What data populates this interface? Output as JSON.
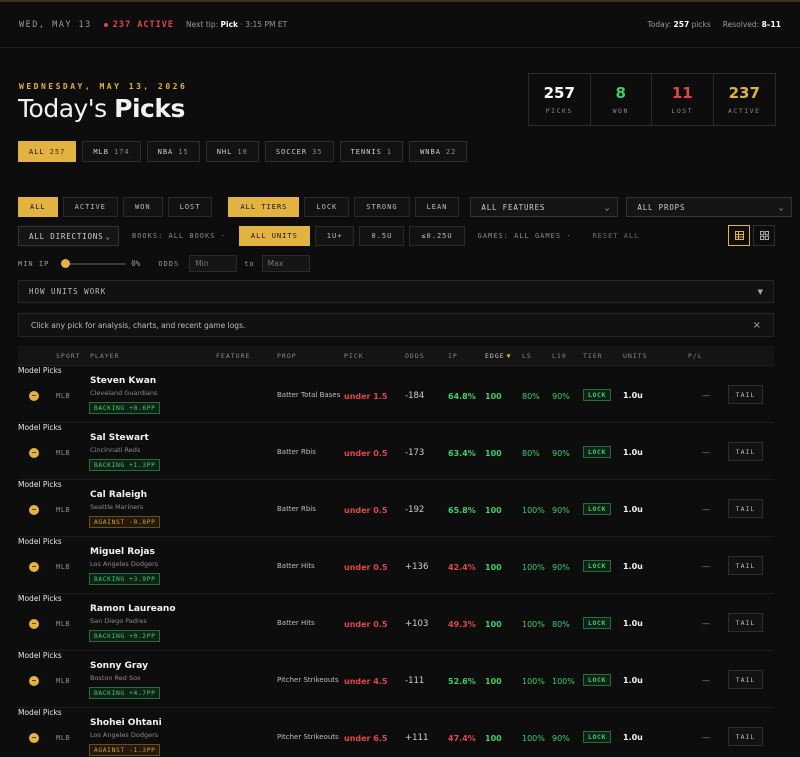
{
  "topbar": {
    "date": "WED, MAY 13",
    "active": "237 ACTIVE",
    "next_tip_label": "Next tip:",
    "next_tip_value": "Pick",
    "next_tip_time": "· 3:15 PM ET",
    "today_label": "Today:",
    "today_value": "257",
    "today_suffix": "picks",
    "resolved_label": "Resolved:",
    "resolved_value": "8–11"
  },
  "header": {
    "subtitle": "WEDNESDAY, MAY 13, 2026",
    "title_light": "Today's",
    "title_bold": "Picks"
  },
  "stats": [
    {
      "value": "257",
      "label": "PICKS",
      "color": "#ffffff"
    },
    {
      "value": "8",
      "label": "WON",
      "color": "#3fcf6a"
    },
    {
      "value": "11",
      "label": "LOST",
      "color": "#e0474c"
    },
    {
      "value": "237",
      "label": "ACTIVE",
      "color": "#e3b341"
    }
  ],
  "sports": [
    {
      "label": "ALL",
      "count": "257"
    },
    {
      "label": "MLB",
      "count": "174"
    },
    {
      "label": "NBA",
      "count": "15"
    },
    {
      "label": "NHL",
      "count": "10"
    },
    {
      "label": "SOCCER",
      "count": "35"
    },
    {
      "label": "TENNIS",
      "count": "1"
    },
    {
      "label": "WNBA",
      "count": "22"
    }
  ],
  "filters": {
    "status": [
      "ALL",
      "ACTIVE",
      "WON",
      "LOST"
    ],
    "tiers": [
      "ALL TIERS",
      "LOCK",
      "STRONG",
      "LEAN"
    ],
    "features_select": "ALL FEATURES",
    "props_select": "ALL PROPS",
    "directions_select": "ALL DIRECTIONS",
    "books": "BOOKS: ALL BOOKS ·",
    "units": [
      "ALL UNITS",
      "1U+",
      "0.5U",
      "≤0.25U"
    ],
    "games": "GAMES: ALL GAMES ·",
    "reset": "RESET ALL",
    "min_ip_label": "MIN IP",
    "min_ip_value": "0%",
    "odds_label": "ODDS",
    "odds_min_placeholder": "Min",
    "odds_to": "to",
    "odds_max_placeholder": "Max"
  },
  "how_units": "HOW UNITS WORK",
  "info_text": "Click any pick for analysis, charts, and recent game logs.",
  "columns": {
    "sport": "SPORT",
    "player": "PLAYER",
    "feature": "FEATURE",
    "prop": "PROP",
    "pick": "PICK",
    "odds": "ODDS",
    "ip": "IP",
    "edge": "EDGE",
    "l5": "L5",
    "l10": "L10",
    "tier": "TIER",
    "units": "UNITS",
    "pl": "P/L"
  },
  "rows": [
    {
      "sport": "MLB",
      "name": "Steven Kwan",
      "team": "Cleveland Guardians",
      "badge": "BACKING +0.6PP",
      "badge_type": "back",
      "feature": "Model Picks",
      "prop": "Batter Total Bases",
      "pick": "under 1.5",
      "odds": "-184",
      "ip": "64.8%",
      "ip_color": "green",
      "edge": "100",
      "l5": "80%",
      "l10": "90%",
      "tier": "LOCK",
      "units": "1.0u",
      "pl": "—",
      "action": "TAIL"
    },
    {
      "sport": "MLB",
      "name": "Sal Stewart",
      "team": "Cincinnati Reds",
      "badge": "BACKING +1.3PP",
      "badge_type": "back",
      "feature": "Model Picks",
      "prop": "Batter Rbis",
      "pick": "under 0.5",
      "odds": "-173",
      "ip": "63.4%",
      "ip_color": "green",
      "edge": "100",
      "l5": "80%",
      "l10": "90%",
      "tier": "LOCK",
      "units": "1.0u",
      "pl": "—",
      "action": "TAIL"
    },
    {
      "sport": "MLB",
      "name": "Cal Raleigh",
      "team": "Seattle Mariners",
      "badge": "AGAINST -0.8PP",
      "badge_type": "against",
      "feature": "Model Picks",
      "prop": "Batter Rbis",
      "pick": "under 0.5",
      "odds": "-192",
      "ip": "65.8%",
      "ip_color": "green",
      "edge": "100",
      "l5": "100%",
      "l10": "90%",
      "tier": "LOCK",
      "units": "1.0u",
      "pl": "—",
      "action": "TAIL"
    },
    {
      "sport": "MLB",
      "name": "Miguel Rojas",
      "team": "Los Angeles Dodgers",
      "badge": "BACKING +3.9PP",
      "badge_type": "back",
      "feature": "Model Picks",
      "prop": "Batter Hits",
      "pick": "under 0.5",
      "odds": "+136",
      "ip": "42.4%",
      "ip_color": "red",
      "edge": "100",
      "l5": "100%",
      "l10": "90%",
      "tier": "LOCK",
      "units": "1.0u",
      "pl": "—",
      "action": "TAIL"
    },
    {
      "sport": "MLB",
      "name": "Ramon Laureano",
      "team": "San Diego Padres",
      "badge": "BACKING +0.2PP",
      "badge_type": "back",
      "feature": "Model Picks",
      "prop": "Batter Hits",
      "pick": "under 0.5",
      "odds": "+103",
      "ip": "49.3%",
      "ip_color": "red",
      "edge": "100",
      "l5": "100%",
      "l10": "80%",
      "tier": "LOCK",
      "units": "1.0u",
      "pl": "—",
      "action": "TAIL"
    },
    {
      "sport": "MLB",
      "name": "Sonny Gray",
      "team": "Boston Red Sox",
      "badge": "BACKING +4.7PP",
      "badge_type": "back",
      "feature": "Model Picks",
      "prop": "Pitcher Strikeouts",
      "pick": "under 4.5",
      "odds": "-111",
      "ip": "52.6%",
      "ip_color": "green",
      "edge": "100",
      "l5": "100%",
      "l10": "100%",
      "tier": "LOCK",
      "units": "1.0u",
      "pl": "—",
      "action": "TAIL"
    },
    {
      "sport": "MLB",
      "name": "Shohei Ohtani",
      "team": "Los Angeles Dodgers",
      "badge": "AGAINST -1.3PP",
      "badge_type": "against",
      "feature": "Model Picks",
      "prop": "Pitcher Strikeouts",
      "pick": "under 6.5",
      "odds": "+111",
      "ip": "47.4%",
      "ip_color": "red",
      "edge": "100",
      "l5": "100%",
      "l10": "90%",
      "tier": "LOCK",
      "units": "1.0u",
      "pl": "—",
      "action": "TAIL"
    }
  ]
}
